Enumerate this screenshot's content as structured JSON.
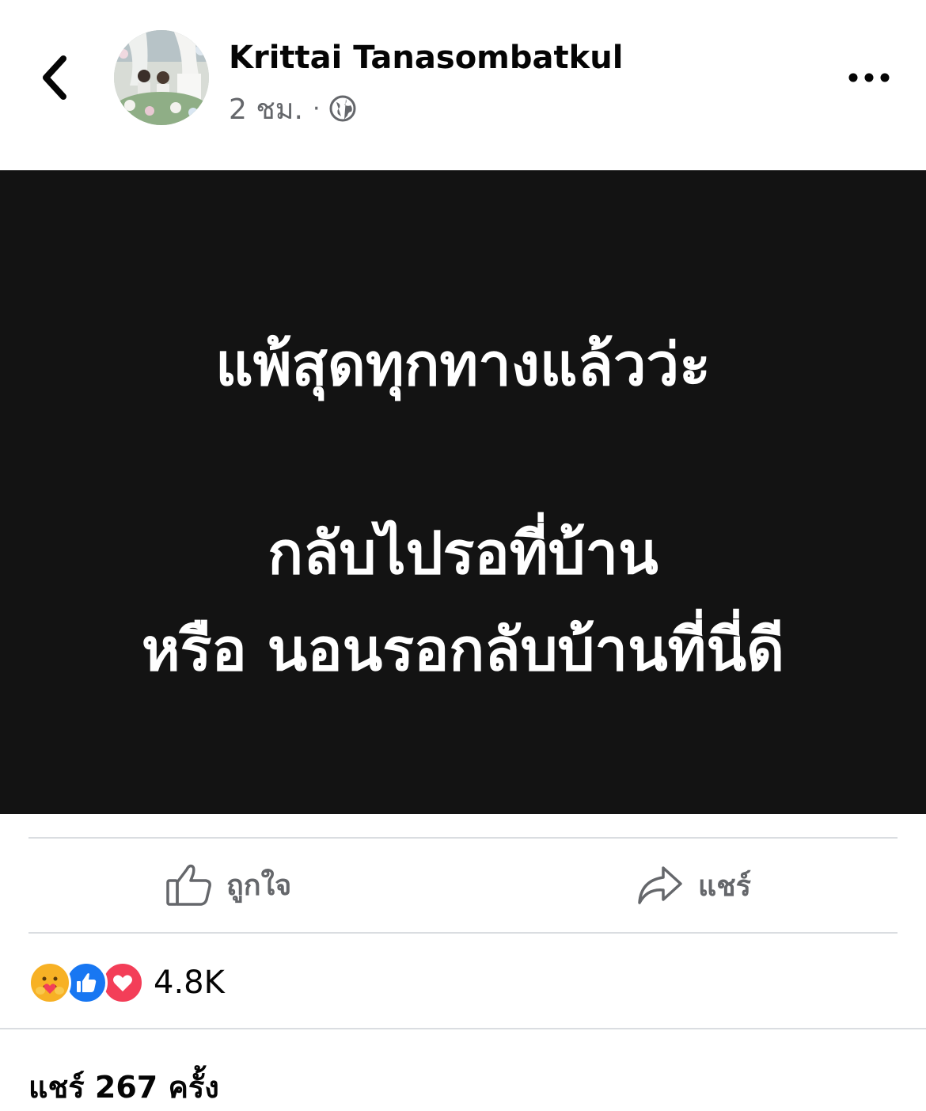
{
  "post": {
    "author": "Krittai Tanasombatkul",
    "time": "2 ชม.",
    "privacy_icon": "globe-icon",
    "image_text": {
      "line1": "แพ้สุดทุกทางแล้วว่ะ",
      "line2": "กลับไปรอที่บ้าน",
      "line3": "หรือ นอนรอกลับบ้านที่นี่ดี"
    }
  },
  "actions": {
    "like_label": "ถูกใจ",
    "share_label": "แชร์"
  },
  "reactions": {
    "icons": [
      "care-icon",
      "like-icon",
      "love-icon"
    ],
    "count": "4.8K"
  },
  "shares": {
    "text": "แชร์ 267 ครั้ง"
  },
  "colors": {
    "image_bg": "#131313",
    "like_blue": "#1877f2",
    "love_red": "#f33e58",
    "care_yellow": "#f7b125",
    "secondary_text": "#65676b"
  }
}
